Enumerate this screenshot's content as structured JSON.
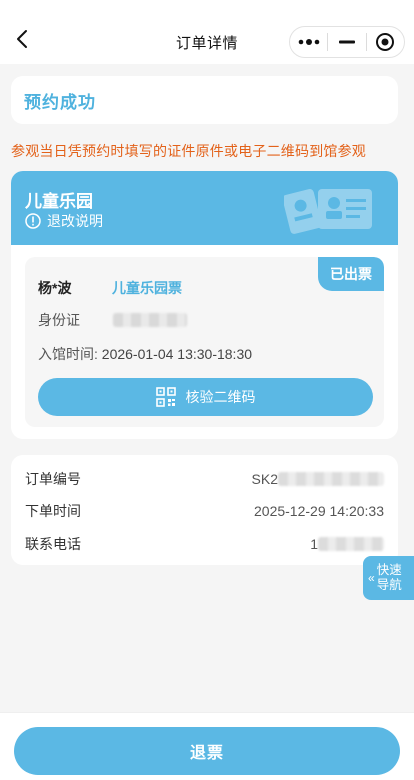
{
  "nav": {
    "title": "订单详情",
    "back_icon": "chevron-left-icon",
    "more_icon": "more-dots-icon",
    "minimize_icon": "minimize-icon",
    "close_icon": "target-close-icon"
  },
  "status": {
    "text": "预约成功"
  },
  "notice": "参观当日凭预约时填写的证件原件或电子二维码到馆参观",
  "ticket": {
    "venue": "儿童乐园",
    "refund_info_label": "退改说明",
    "badge": "已出票",
    "visitor_name": "杨*波",
    "ticket_type": "儿童乐园票",
    "id_label": "身份证",
    "entry_label": "入馆时间:",
    "entry_time": "2026-01-04 13:30-18:30",
    "qr_button": "核验二维码"
  },
  "order": {
    "rows": [
      {
        "label": "订单编号",
        "value": "SK2"
      },
      {
        "label": "下单时间",
        "value": "2025-12-29 14:20:33"
      },
      {
        "label": "联系电话",
        "value": "1"
      }
    ]
  },
  "quick_nav": {
    "line1": "快速",
    "line2": "导航",
    "arrow": "«"
  },
  "bottom": {
    "refund_button": "退票"
  },
  "colors": {
    "accent": "#5bb8e4",
    "notice": "#e3621a",
    "background": "#f5f5f5"
  }
}
